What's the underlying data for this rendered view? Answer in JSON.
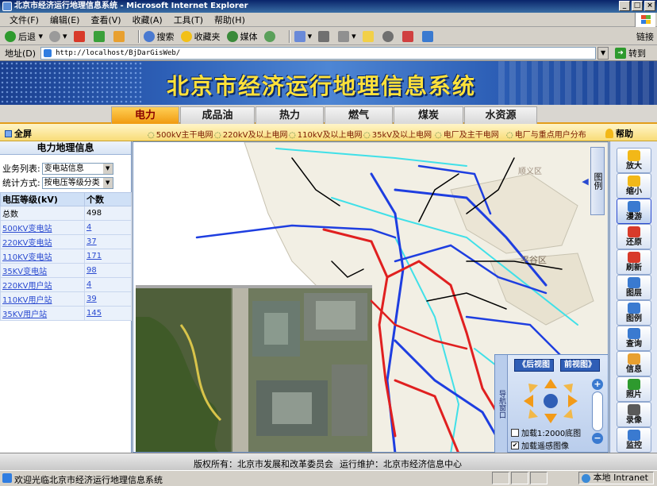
{
  "window": {
    "title": "北京市经济运行地理信息系统 - Microsoft Internet Explorer"
  },
  "menu": [
    "文件(F)",
    "编辑(E)",
    "查看(V)",
    "收藏(A)",
    "工具(T)",
    "帮助(H)"
  ],
  "toolbar": {
    "back": "后退",
    "search": "搜索",
    "favorites": "收藏夹",
    "media": "媒体",
    "links": "链接"
  },
  "address": {
    "label": "地址(D)",
    "url": "http://localhost/BjDarGisWeb/",
    "go": "转到"
  },
  "banner": {
    "title": "北京市经济运行地理信息系统"
  },
  "tabs": [
    "电力",
    "成品油",
    "热力",
    "燃气",
    "煤炭",
    "水资源"
  ],
  "active_tab": "电力",
  "subnav": {
    "fullscreen": "全屏",
    "links": [
      "500kV主干电网",
      "220kV及以上电网",
      "110kV及以上电网",
      "35kV及以上电网",
      "电厂及主干电网",
      "电厂与重点用户分布"
    ],
    "help": "帮助"
  },
  "left": {
    "title": "电力地理信息",
    "business_label": "业务列表:",
    "business_value": "变电站信息",
    "stat_label": "统计方式:",
    "stat_value": "按电压等级分类",
    "table_headers": [
      "电压等级(kV)",
      "个数"
    ],
    "rows": [
      {
        "name": "总数",
        "count": "498",
        "link": false
      },
      {
        "name": "500KV变电站",
        "count": "4",
        "link": true
      },
      {
        "name": "220KV变电站",
        "count": "37",
        "link": true
      },
      {
        "name": "110KV变电站",
        "count": "171",
        "link": true
      },
      {
        "name": "35KV变电站",
        "count": "98",
        "link": true
      },
      {
        "name": "220KV用户站",
        "count": "4",
        "link": true
      },
      {
        "name": "110KV用户站",
        "count": "39",
        "link": true
      },
      {
        "name": "35KV用户站",
        "count": "145",
        "link": true
      }
    ]
  },
  "map": {
    "legend_tab": "图例",
    "district_labels": [
      "平谷区",
      "顺义区"
    ],
    "nav": {
      "vertical_label": "导航窗口",
      "back_view": "《后视图",
      "fwd_view": "前视图》",
      "chk1": "加载1:2000底图",
      "chk2": "加载遥感图像",
      "chk1_checked": false,
      "chk2_checked": true
    }
  },
  "tools": [
    {
      "label": "放大",
      "icon": "zoom-in-icon"
    },
    {
      "label": "缩小",
      "icon": "zoom-out-icon"
    },
    {
      "label": "漫游",
      "icon": "pan-hand-icon"
    },
    {
      "label": "还原",
      "icon": "restore-icon"
    },
    {
      "label": "刷新",
      "icon": "refresh-icon"
    },
    {
      "label": "图层",
      "icon": "layers-icon"
    },
    {
      "label": "图例",
      "icon": "legend-icon"
    },
    {
      "label": "查询",
      "icon": "query-icon"
    },
    {
      "label": "信息",
      "icon": "info-icon"
    },
    {
      "label": "照片",
      "icon": "photo-icon"
    },
    {
      "label": "录像",
      "icon": "video-icon"
    },
    {
      "label": "监控",
      "icon": "monitor-icon"
    }
  ],
  "footer": {
    "copyright": "版权所有：北京市发展和改革委员会",
    "maintainer": "运行维护：北京市经济信息中心"
  },
  "status": {
    "text": "欢迎光临北京市经济运行地理信息系统",
    "zone": "本地 Intranet"
  },
  "colors": {
    "tab_active": "#f09a10",
    "banner_title": "#ffe13a",
    "line_red": "#e02020",
    "line_blue": "#1e3ee0",
    "line_cyan": "#40e0e8"
  }
}
